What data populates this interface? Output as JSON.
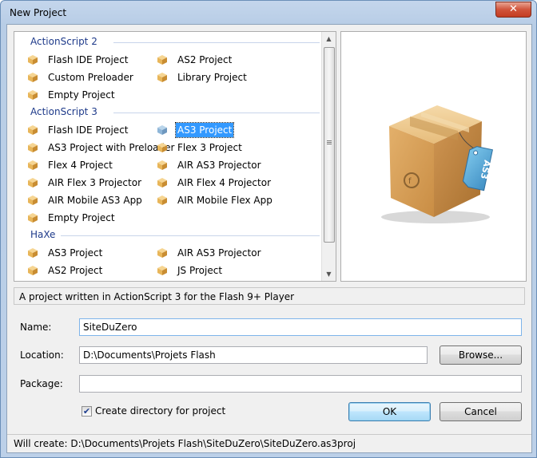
{
  "window": {
    "title": "New Project",
    "close_glyph": "✕"
  },
  "templates": {
    "groups": [
      {
        "header": "ActionScript 2",
        "items": [
          {
            "label": "Flash IDE Project",
            "icon": "package-icon"
          },
          {
            "label": "AS2 Project",
            "icon": "package-icon"
          },
          {
            "label": "Custom Preloader",
            "icon": "package-icon"
          },
          {
            "label": "Library Project",
            "icon": "package-icon"
          },
          {
            "label": "Empty Project",
            "icon": "package-icon"
          }
        ]
      },
      {
        "header": "ActionScript 3",
        "items": [
          {
            "label": "Flash IDE Project",
            "icon": "package-icon"
          },
          {
            "label": "AS3 Project",
            "icon": "package-icon",
            "selected": true
          },
          {
            "label": "AS3 Project with Preloader",
            "icon": "package-icon"
          },
          {
            "label": "Flex 3 Project",
            "icon": "package-icon"
          },
          {
            "label": "Flex 4 Project",
            "icon": "package-icon"
          },
          {
            "label": "AIR AS3 Projector",
            "icon": "package-icon"
          },
          {
            "label": "AIR Flex 3 Projector",
            "icon": "package-icon"
          },
          {
            "label": "AIR Flex 4 Projector",
            "icon": "package-icon"
          },
          {
            "label": "AIR Mobile AS3 App",
            "icon": "package-icon"
          },
          {
            "label": "AIR Mobile Flex App",
            "icon": "package-icon"
          },
          {
            "label": "Empty Project",
            "icon": "package-icon"
          }
        ]
      },
      {
        "header": "HaXe",
        "items": [
          {
            "label": "AS3 Project",
            "icon": "package-icon"
          },
          {
            "label": "AIR AS3 Projector",
            "icon": "package-icon"
          },
          {
            "label": "AS2 Project",
            "icon": "package-icon"
          },
          {
            "label": "JS Project",
            "icon": "package-icon"
          }
        ]
      }
    ]
  },
  "preview": {
    "icon": "as3-package-box-icon",
    "tag_text": "AS3"
  },
  "description": "A project written in ActionScript 3 for the Flash 9+ Player",
  "form": {
    "name_label": "Name:",
    "name_value": "SiteDuZero",
    "location_label": "Location:",
    "location_value": "D:\\Documents\\Projets Flash",
    "browse_label": "Browse...",
    "package_label": "Package:",
    "package_value": "",
    "create_dir_label": "Create directory for project",
    "create_dir_checked": true,
    "ok_label": "OK",
    "cancel_label": "Cancel"
  },
  "status": "Will create: D:\\Documents\\Projets Flash\\SiteDuZero\\SiteDuZero.as3proj",
  "colors": {
    "selection": "#3399ff",
    "group_header": "#1e3a8a",
    "box_tan": "#d9a766"
  }
}
